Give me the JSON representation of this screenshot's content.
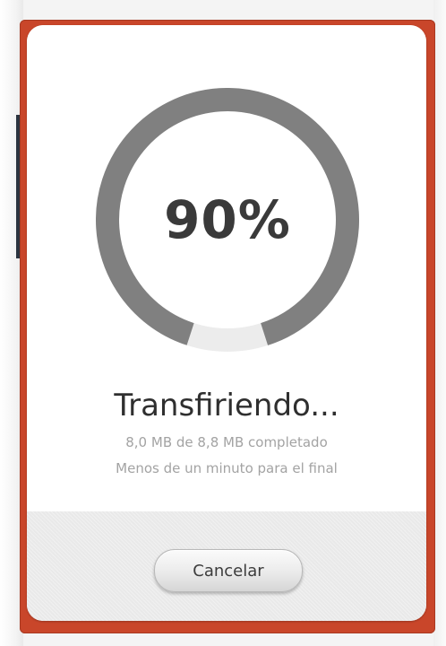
{
  "progress": {
    "percent_label": "90%",
    "fraction": 0.9,
    "track_color": "#ececec",
    "fill_color": "#808080"
  },
  "status": {
    "title": "Transfiriendo...",
    "detail": "8,0 MB de 8,8 MB completado",
    "eta": "Menos de un minuto para el final"
  },
  "footer": {
    "cancel_label": "Cancelar"
  },
  "colors": {
    "frame_accent": "#c9462a"
  }
}
